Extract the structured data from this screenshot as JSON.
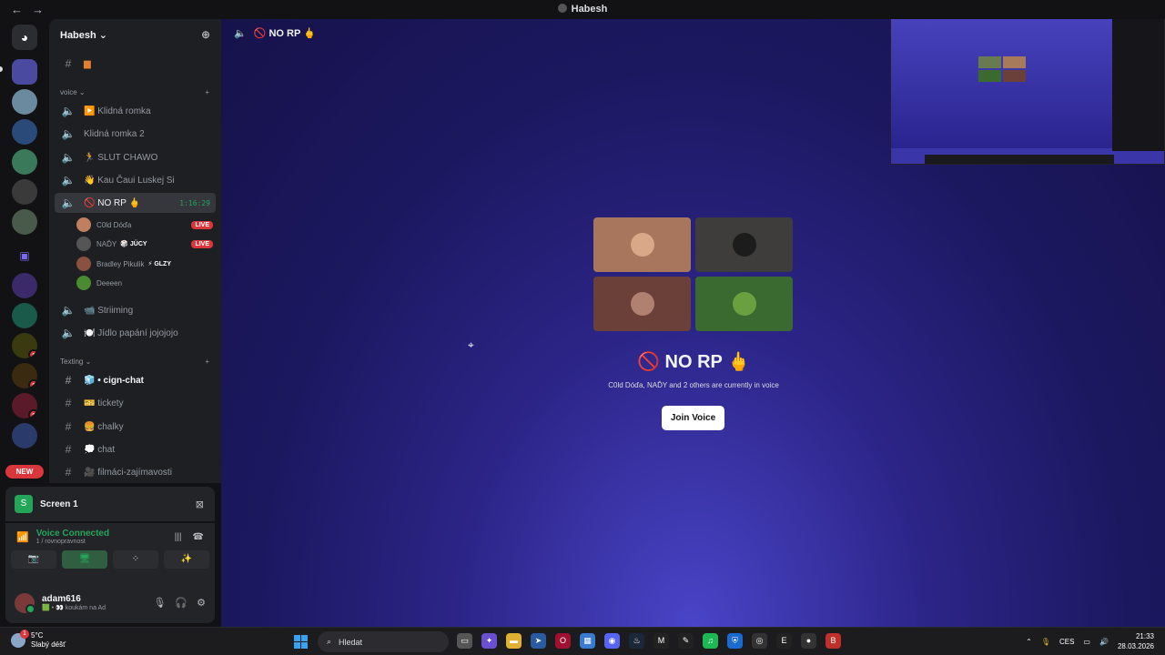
{
  "window": {
    "title": "Habesh",
    "back_icon": "←",
    "forward_icon": "→"
  },
  "guild": {
    "name": "Habesh ⌄",
    "invite_icon": "person-add-icon"
  },
  "sidebar": {
    "top_channel": {
      "icon": "#",
      "label": "▆"
    },
    "voice_category": "voice ⌄",
    "voice_channels": [
      {
        "label": "▶️ Klidná romka"
      },
      {
        "label": "Klidná romka 2"
      },
      {
        "label": "🏃 SLUT CHAWO"
      },
      {
        "label": "👋 Kau Čaui Luskej Si"
      }
    ],
    "active_channel": {
      "label": "🚫 NO RP 🖕",
      "timer": "1:16:29"
    },
    "members": [
      {
        "name": "C0ld Dóďa",
        "tag": "",
        "live": "LIVE",
        "color": "#c08060"
      },
      {
        "name": "NAĎY",
        "tag": "🎲 JÜCY",
        "live": "LIVE",
        "color": "#555"
      },
      {
        "name": "Bradley Pikulik",
        "tag": "⚡ GLZY",
        "live": "",
        "color": "#8a5040"
      },
      {
        "name": "Deeeen",
        "tag": "",
        "live": "",
        "color": "#4a8a30"
      }
    ],
    "more_voice_channels": [
      {
        "label": "📹 Striiming"
      },
      {
        "label": "🍽️ Jídlo papání jojojojo"
      }
    ],
    "text_category": "Texting ⌄",
    "text_channels": [
      {
        "label": "🧊 • cign-chat",
        "unread": true
      },
      {
        "label": "🎫 tickety",
        "unread": false
      },
      {
        "label": "🍔 chalky",
        "unread": false
      },
      {
        "label": "💭 chat",
        "unread": false
      },
      {
        "label": "🎥 filmáci-zajímavosti",
        "unread": false
      }
    ],
    "plus": "+"
  },
  "servers": {
    "badges": [
      "1",
      "1",
      "1"
    ],
    "new_label": "NEW"
  },
  "screen_share": {
    "label": "Screen 1",
    "icon_letter": "S"
  },
  "voice_panel": {
    "status": "Voice Connected",
    "location": "1 / rovnopravnost",
    "controls": [
      "📷",
      "🖥",
      "⁘",
      "✨"
    ]
  },
  "user": {
    "name": "adam616",
    "status": "🟩 • 👀 koukám na Ad"
  },
  "main": {
    "channel_name": "🚫 NO RP 🖕",
    "title": "🚫 NO RP 🖕",
    "description": "C0ld Dóďa, NAĎY and 2 others are currently in voice",
    "join_button": "Join Voice",
    "tiles": [
      {
        "color": "#a8765c",
        "face": "#d9a889"
      },
      {
        "color": "#3f3d3b",
        "face": "#1c1c1c"
      },
      {
        "color": "#6a4038",
        "face": "#b08070"
      },
      {
        "color": "#3a6a30",
        "face": "#6aa040"
      }
    ]
  },
  "taskbar": {
    "temperature": "5°C",
    "weather": "Slabý déšť",
    "weather_badge": "1",
    "search_placeholder": "Hledat",
    "language": "CES",
    "time": "21:33",
    "date": "28.03.2026",
    "apps": [
      {
        "icon": "▭",
        "color": "#555"
      },
      {
        "icon": "✦",
        "color": "#6a4fd0"
      },
      {
        "icon": "▬",
        "color": "#e0b030"
      },
      {
        "icon": "➤",
        "color": "#2a5aa0"
      },
      {
        "icon": "O",
        "color": "#a01030"
      },
      {
        "icon": "▦",
        "color": "#3a7ad0"
      },
      {
        "icon": "◉",
        "color": "#5865f2"
      },
      {
        "icon": "♨",
        "color": "#1b2838"
      },
      {
        "icon": "M",
        "color": "#222"
      },
      {
        "icon": "✎",
        "color": "#222"
      },
      {
        "icon": "♫",
        "color": "#1db954"
      },
      {
        "icon": "⛨",
        "color": "#1a6ad0"
      },
      {
        "icon": "◎",
        "color": "#333"
      },
      {
        "icon": "E",
        "color": "#222"
      },
      {
        "icon": "●",
        "color": "#333"
      },
      {
        "icon": "B",
        "color": "#c0302a"
      }
    ]
  }
}
